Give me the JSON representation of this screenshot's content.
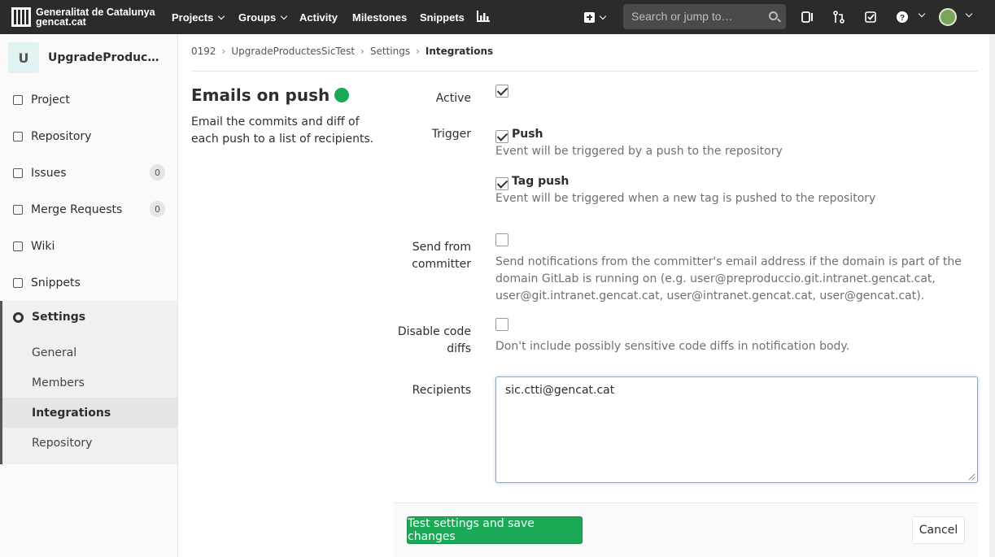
{
  "navbar": {
    "brand_line1": "Generalitat de Catalunya",
    "brand_line2": "gencat.cat",
    "items": [
      {
        "label": "Projects"
      },
      {
        "label": "Groups"
      },
      {
        "label": "Activity"
      },
      {
        "label": "Milestones"
      },
      {
        "label": "Snippets"
      }
    ],
    "search_placeholder": "Search or jump to…"
  },
  "sidebar": {
    "project_initial": "U",
    "project_name": "UpgradeProductesSicTest",
    "items": [
      {
        "label": "Project"
      },
      {
        "label": "Repository"
      },
      {
        "label": "Issues",
        "count": "0"
      },
      {
        "label": "Merge Requests",
        "count": "0"
      },
      {
        "label": "Wiki"
      },
      {
        "label": "Snippets"
      }
    ],
    "settings": {
      "label": "Settings",
      "sub": [
        {
          "label": "General"
        },
        {
          "label": "Members"
        },
        {
          "label": "Integrations"
        },
        {
          "label": "Repository"
        }
      ]
    }
  },
  "breadcrumb": [
    "0192",
    "UpgradeProductesSicTest",
    "Settings",
    "Integrations"
  ],
  "service": {
    "title": "Emails on push",
    "description": "Email the commits and diff of each push to a list of recipients.",
    "status_color": "#1aaa55"
  },
  "form": {
    "active_label": "Active",
    "trigger_label": "Trigger",
    "push_label": "Push",
    "push_help": "Event will be triggered by a push to the repository",
    "tag_push_label": "Tag push",
    "tag_push_help": "Event will be triggered when a new tag is pushed to the repository",
    "send_from_label_1": "Send from",
    "send_from_label_2": "committer",
    "send_from_help": "Send notifications from the committer's email address if the domain is part of the domain GitLab is running on (e.g. user@preproduccio.git.intranet.gencat.cat, user@git.intranet.gencat.cat, user@intranet.gencat.cat, user@gencat.cat).",
    "disable_diffs_label_1": "Disable code",
    "disable_diffs_label_2": "diffs",
    "disable_diffs_help": "Don't include possibly sensitive code diffs in notification body.",
    "recipients_label": "Recipients",
    "recipients_value": "sic.ctti@gencat.cat"
  },
  "buttons": {
    "save": "Test settings and save changes",
    "cancel": "Cancel"
  }
}
